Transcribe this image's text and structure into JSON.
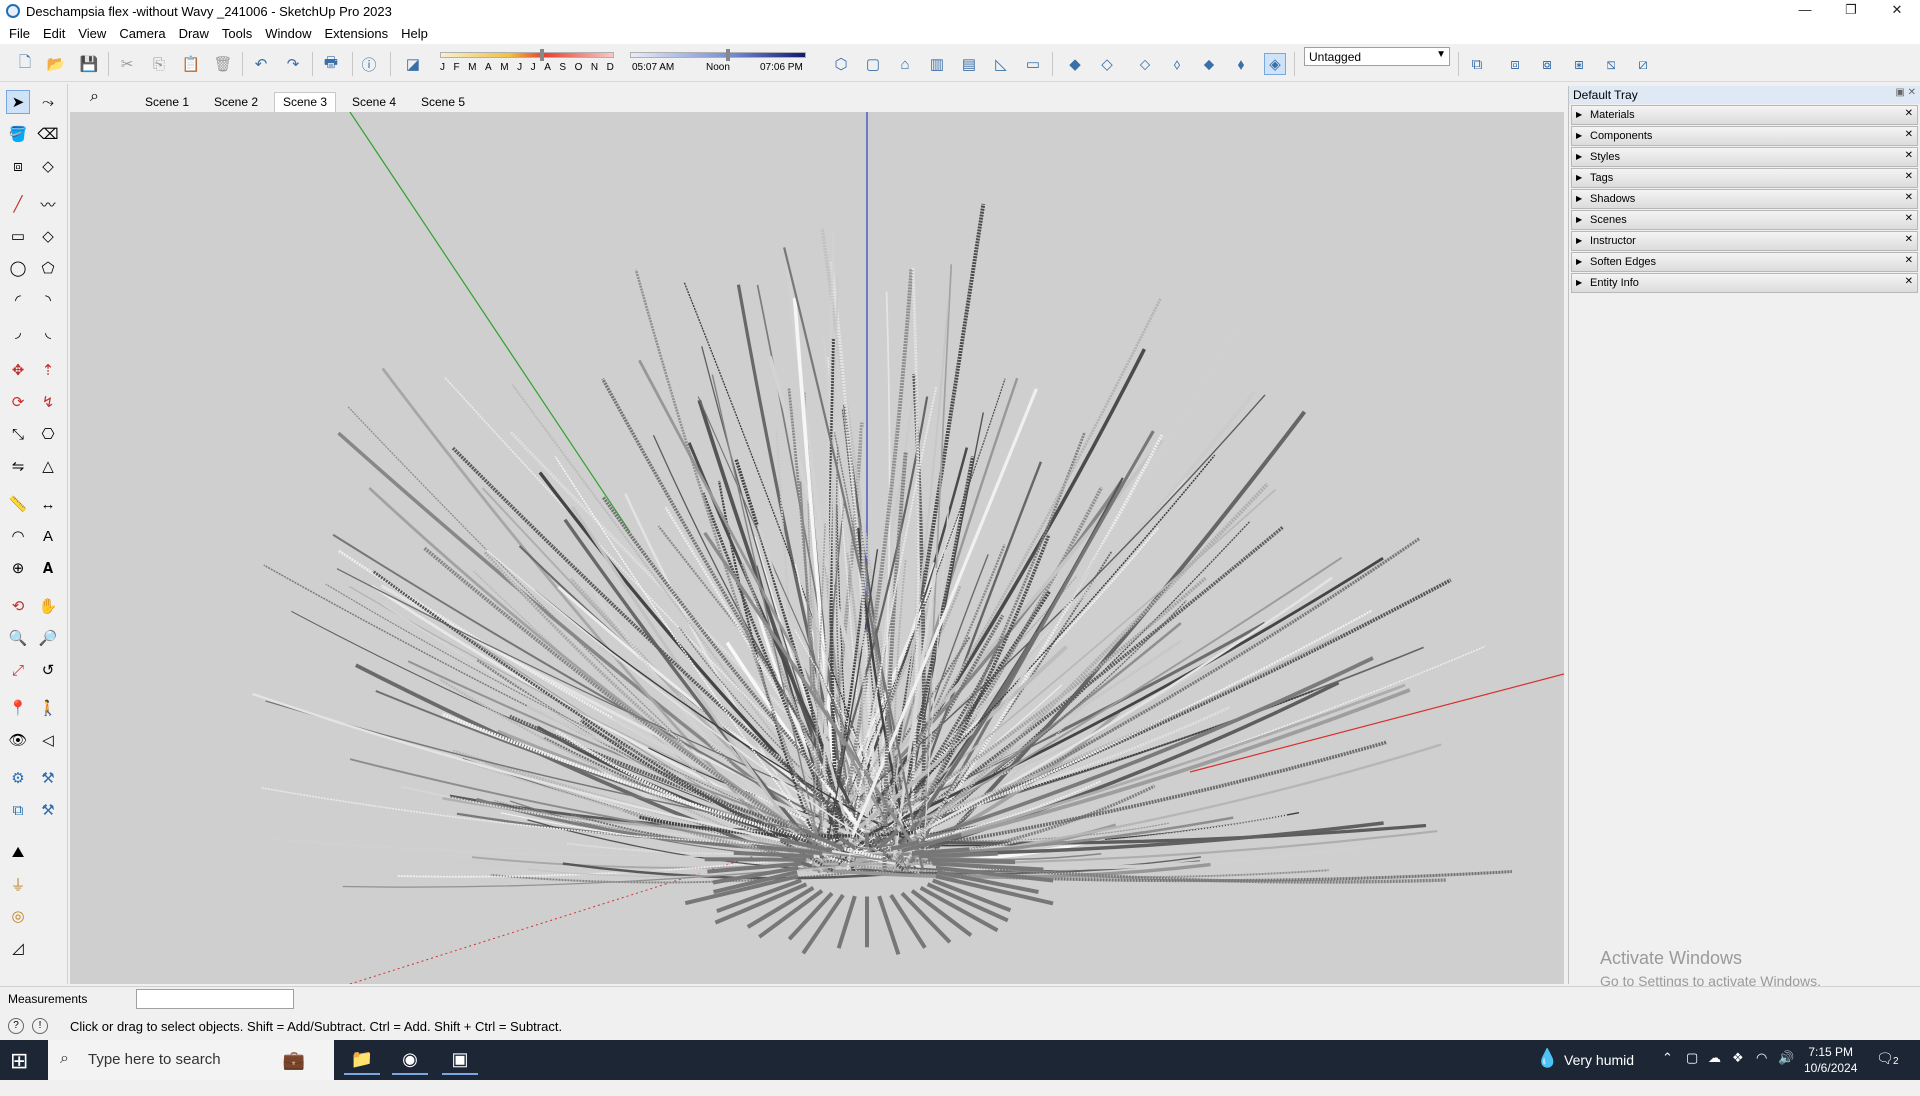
{
  "window": {
    "title": "Deschampsia flex -without Wavy _241006 - SketchUp Pro 2023",
    "minimize": "—",
    "restore": "❐",
    "close": "✕"
  },
  "menu": [
    "File",
    "Edit",
    "View",
    "Camera",
    "Draw",
    "Tools",
    "Window",
    "Extensions",
    "Help"
  ],
  "shadow": {
    "months": [
      "J",
      "F",
      "M",
      "A",
      "M",
      "J",
      "J",
      "A",
      "S",
      "O",
      "N",
      "D"
    ],
    "time_start": "05:07 AM",
    "time_mid": "Noon",
    "time_end": "07:06 PM"
  },
  "tag_select": {
    "value": "Untagged"
  },
  "scenes": [
    {
      "label": "Scene 1",
      "active": false
    },
    {
      "label": "Scene 2",
      "active": false
    },
    {
      "label": "Scene 3",
      "active": true
    },
    {
      "label": "Scene 4",
      "active": false
    },
    {
      "label": "Scene 5",
      "active": false
    }
  ],
  "tray": {
    "title": "Default Tray",
    "panels": [
      "Materials",
      "Components",
      "Styles",
      "Tags",
      "Shadows",
      "Scenes",
      "Instructor",
      "Soften Edges",
      "Entity Info"
    ]
  },
  "watermark": {
    "line1": "Activate Windows",
    "line2": "Go to Settings to activate Windows."
  },
  "measurements": {
    "label": "Measurements",
    "value": ""
  },
  "status": {
    "hint": "Click or drag to select objects. Shift = Add/Subtract. Ctrl = Add. Shift + Ctrl = Subtract."
  },
  "taskbar": {
    "search_placeholder": "Type here to search",
    "weather": "Very humid",
    "time": "7:15 PM",
    "date": "10/6/2024",
    "notifications": "2"
  },
  "colors": {
    "axis_red": "#d83030",
    "axis_green": "#30a030",
    "axis_blue": "#3040c0",
    "viewport_bg": "#cfcfcf"
  }
}
